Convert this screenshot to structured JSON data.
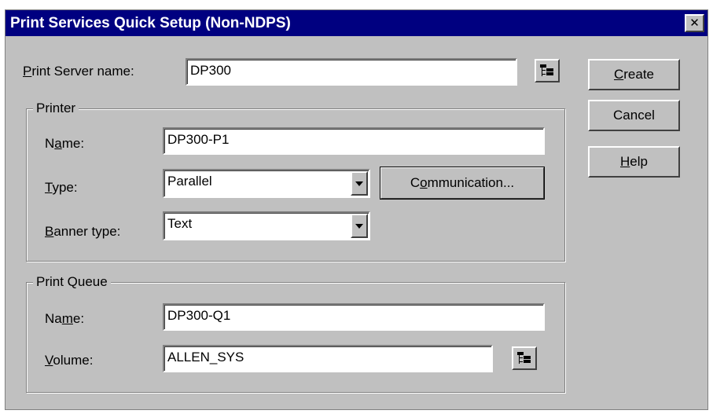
{
  "window": {
    "title": "Print Services Quick Setup (Non-NDPS)",
    "close_label": "✕"
  },
  "server": {
    "label_u": "P",
    "label_rest": "rint Server name:",
    "value": "DP300"
  },
  "printer_group": {
    "title": "Printer",
    "name_label_pre": "N",
    "name_label_u": "a",
    "name_label_post": "me:",
    "name_value": "DP300-P1",
    "type_label_u": "T",
    "type_label_post": "ype:",
    "type_value": "Parallel",
    "banner_label_u": "B",
    "banner_label_post": "anner type:",
    "banner_value": "Text",
    "communication_pre": "C",
    "communication_u": "o",
    "communication_post": "mmunication..."
  },
  "queue_group": {
    "title": "Print Queue",
    "name_label_pre": "Na",
    "name_label_u": "m",
    "name_label_post": "e:",
    "name_value": "DP300-Q1",
    "volume_label_u": "V",
    "volume_label_post": "olume:",
    "volume_value": "ALLEN_SYS"
  },
  "buttons": {
    "create_u": "C",
    "create_post": "reate",
    "cancel": "Cancel",
    "help_u": "H",
    "help_post": "elp"
  },
  "colors": {
    "titlebar": "#000080",
    "dialog_bg": "#c0c0c0",
    "field_bg": "#ffffff"
  },
  "icons": {
    "close": "close-icon",
    "browse": "browse-tree-icon",
    "dropdown": "chevron-down-icon"
  }
}
